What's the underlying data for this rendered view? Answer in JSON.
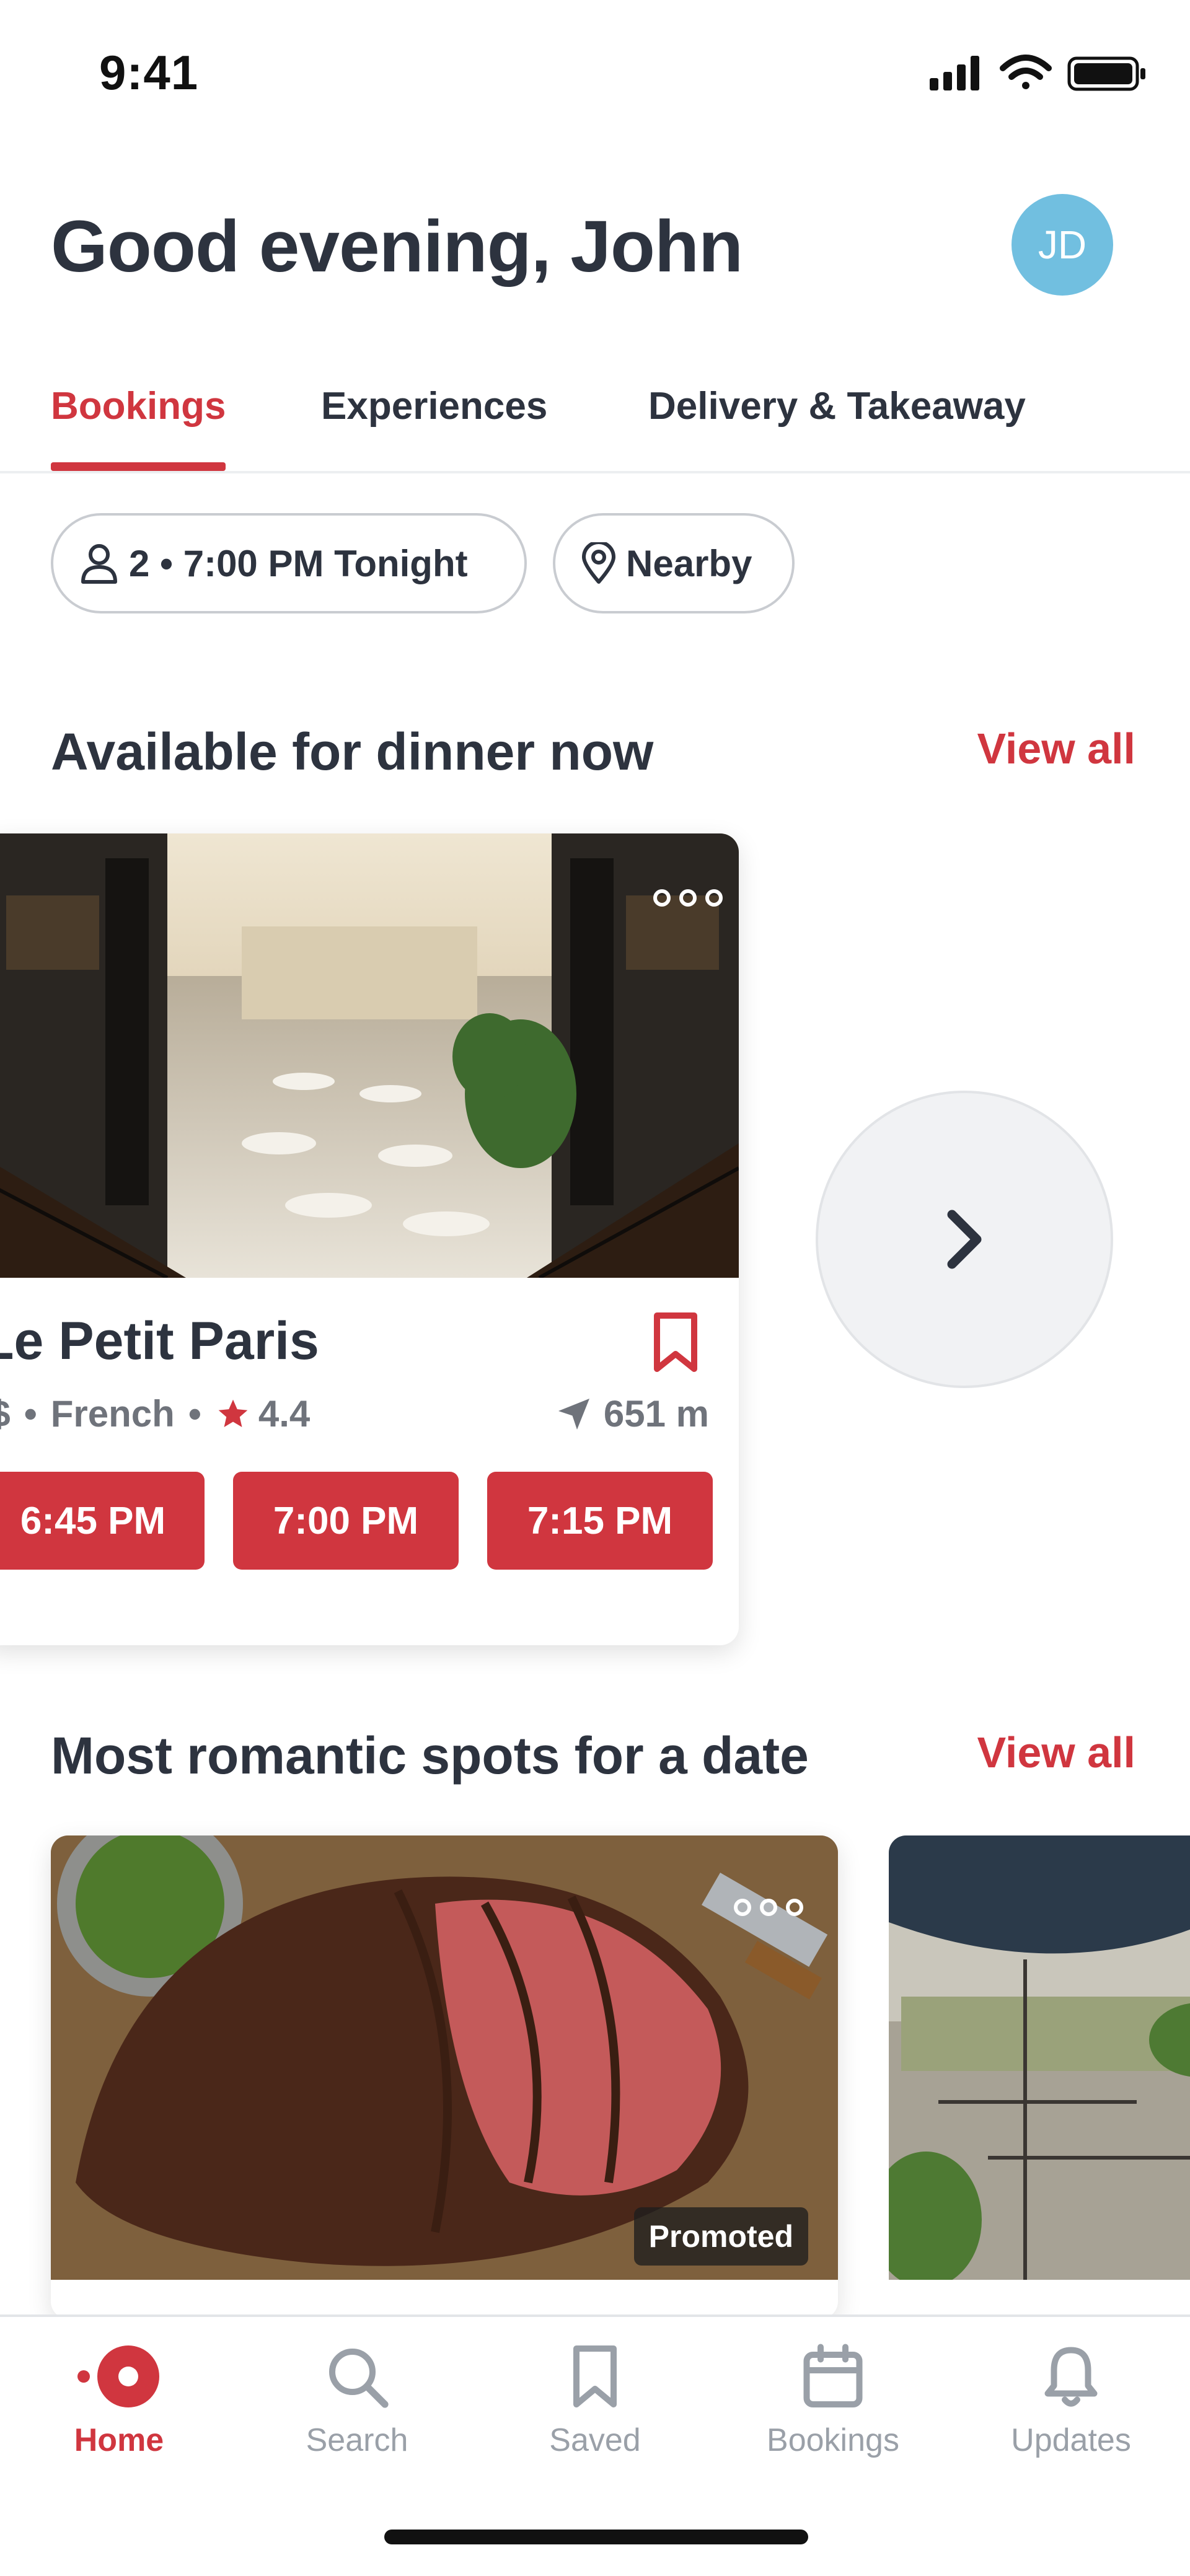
{
  "status_bar": {
    "time": "9:41",
    "icons": [
      "signal-icon",
      "wifi-icon",
      "battery-icon"
    ]
  },
  "header": {
    "greeting": "Good evening, John",
    "avatar_initials": "JD"
  },
  "tabs": [
    {
      "label": "Bookings",
      "active": true
    },
    {
      "label": "Experiences",
      "active": false
    },
    {
      "label": "Delivery & Takeaway",
      "active": false
    }
  ],
  "filters": {
    "party": "2 • 7:00 PM Tonight",
    "location": "Nearby"
  },
  "section_available": {
    "title": "Available for dinner now",
    "view_all": "View all",
    "restaurant": {
      "name": "Le Petit Paris",
      "price": "$$",
      "cuisine": "French",
      "rating": "4.4",
      "distance": "651 m",
      "slots": [
        "6:45 PM",
        "7:00 PM",
        "7:15 PM"
      ]
    }
  },
  "section_romantic": {
    "title": "Most romantic spots for a date",
    "view_all": "View all",
    "promoted_label": "Promoted"
  },
  "bottom_nav": [
    {
      "label": "Home",
      "icon": "home-icon",
      "active": true
    },
    {
      "label": "Search",
      "icon": "search-icon",
      "active": false
    },
    {
      "label": "Saved",
      "icon": "bookmark-icon",
      "active": false
    },
    {
      "label": "Bookings",
      "icon": "calendar-icon",
      "active": false
    },
    {
      "label": "Updates",
      "icon": "bell-icon",
      "active": false
    }
  ],
  "colors": {
    "accent": "#d0363f",
    "avatar": "#71bfe0",
    "text": "#2d333f",
    "muted": "#9aa0a8"
  }
}
